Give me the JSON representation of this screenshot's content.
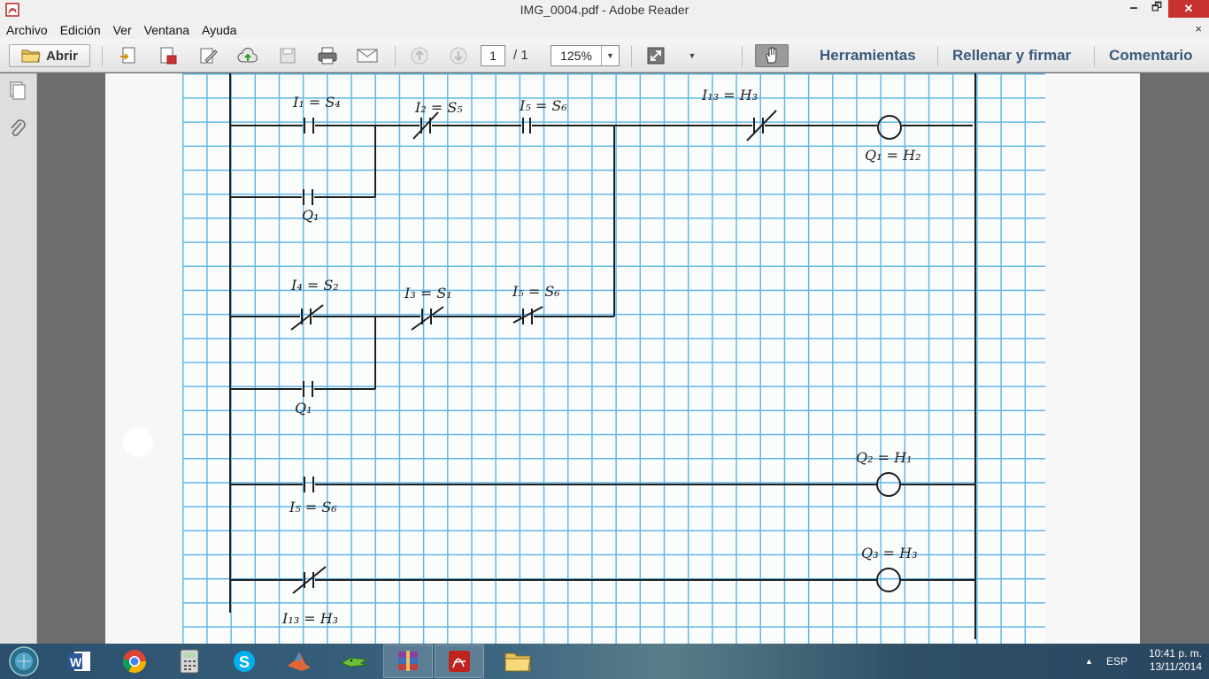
{
  "window": {
    "title": "IMG_0004.pdf - Adobe Reader",
    "minimize_glyph": "🗕",
    "maximize_glyph": "🗗",
    "close_glyph": "✕"
  },
  "menu": {
    "items": [
      "Archivo",
      "Edición",
      "Ver",
      "Ventana",
      "Ayuda"
    ],
    "close_glyph": "×"
  },
  "toolbar": {
    "open_label": "Abrir",
    "page_current": "1",
    "page_total": "/ 1",
    "zoom": "125%",
    "tools_label": "Herramientas",
    "fill_sign_label": "Rellenar y firmar",
    "comment_label": "Comentario"
  },
  "ladder_labels": {
    "r1_c1": "I₁ = S₄",
    "r1_c2": "I₂ = S₅",
    "r1_c3": "I₅ = S₆",
    "r1_c4": "I₁₃ = H₃",
    "r1_coil": "Q₁ = H₂",
    "r1_branch": "Q₁",
    "r2_c1": "I₄ = S₂",
    "r2_c2": "I₃ = S₁",
    "r2_c3": "I₅ = S₆",
    "r2_branch": "Q₁",
    "r3_coil": "Q₂ = H₁",
    "r3_c1": "I₅ = S₆",
    "r4_coil": "Q₃ = H₃",
    "r4_c1": "I₁₃ = H₃"
  },
  "taskbar": {
    "apps": [
      "windows-start",
      "word",
      "chrome",
      "calculator",
      "skype",
      "matlab",
      "crocodile",
      "winrar",
      "adobe-reader",
      "file-explorer"
    ],
    "language": "ESP",
    "time": "10:41 p. m.",
    "date": "13/11/2014",
    "tray_arrow": "▲"
  }
}
